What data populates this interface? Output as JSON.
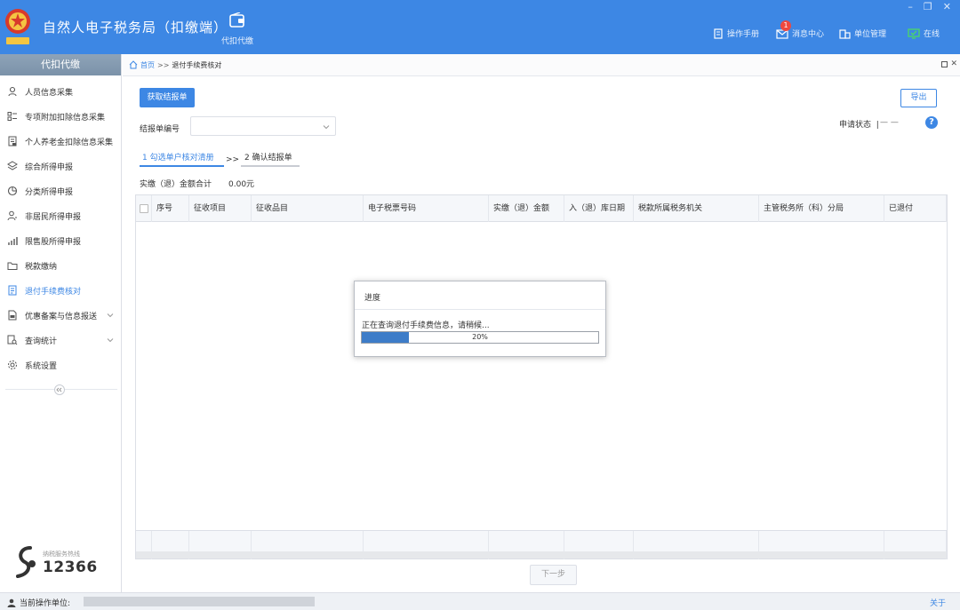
{
  "header": {
    "title": "自然人电子税务局（扣缴端）",
    "tab_label": "代扣代缴",
    "items": {
      "manual": "操作手册",
      "messages": "消息中心",
      "unit": "单位管理",
      "online": "在线"
    },
    "message_badge": "1",
    "window_controls": {
      "minimize": "–",
      "restore": "❐",
      "close": "✕"
    },
    "colors": {
      "brand": "#3d87e4",
      "online": "#4cd964"
    }
  },
  "sidebar": {
    "header": "代扣代缴",
    "items": [
      {
        "label": "人员信息采集",
        "icon": "person-icon"
      },
      {
        "label": "专项附加扣除信息采集",
        "icon": "grid-list-icon"
      },
      {
        "label": "个人养老金扣除信息采集",
        "icon": "document-list-icon"
      },
      {
        "label": "综合所得申报",
        "icon": "layers-icon"
      },
      {
        "label": "分类所得申报",
        "icon": "pie-icon"
      },
      {
        "label": "非居民所得申报",
        "icon": "user-outline-icon"
      },
      {
        "label": "限售股所得申报",
        "icon": "bar-chart-icon"
      },
      {
        "label": "税款缴纳",
        "icon": "folder-icon"
      },
      {
        "label": "退付手续费核对",
        "icon": "checklist-icon",
        "active": true
      },
      {
        "label": "优惠备案与信息报送",
        "icon": "file-icon",
        "expandable": true
      },
      {
        "label": "查询统计",
        "icon": "search-doc-icon",
        "expandable": true
      },
      {
        "label": "系统设置",
        "icon": "gear-icon"
      }
    ],
    "hotline_label": "纳税服务热线",
    "hotline_number": "12366"
  },
  "breadcrumb": {
    "home": "首页",
    "separator": ">>",
    "current": "退付手续费核对"
  },
  "toolbar": {
    "fetch_button": "获取结报单",
    "export_button": "导出",
    "report_label": "结报单编号",
    "report_value": "",
    "status_label": "申请状态",
    "status_sep": "|",
    "status_value": "— —"
  },
  "steps": {
    "step1": "1 勾选单户核对清册",
    "arrow": ">>",
    "step2": "2 确认结报单"
  },
  "summary": {
    "label": "实缴（退）金额合计",
    "value": "0.00元"
  },
  "table": {
    "columns": [
      "序号",
      "征收项目",
      "征收品目",
      "电子税票号码",
      "实缴（退）金额",
      "入（退）库日期",
      "税款所属税务机关",
      "主管税务所（科）分局",
      "已退付"
    ]
  },
  "next_button": "下一步",
  "dialog": {
    "title": "进度",
    "message": "正在查询退付手续费信息，请稍候...",
    "progress": 20,
    "progress_text": "20%"
  },
  "statusbar": {
    "user_label": "当前操作单位:",
    "about": "关于"
  }
}
